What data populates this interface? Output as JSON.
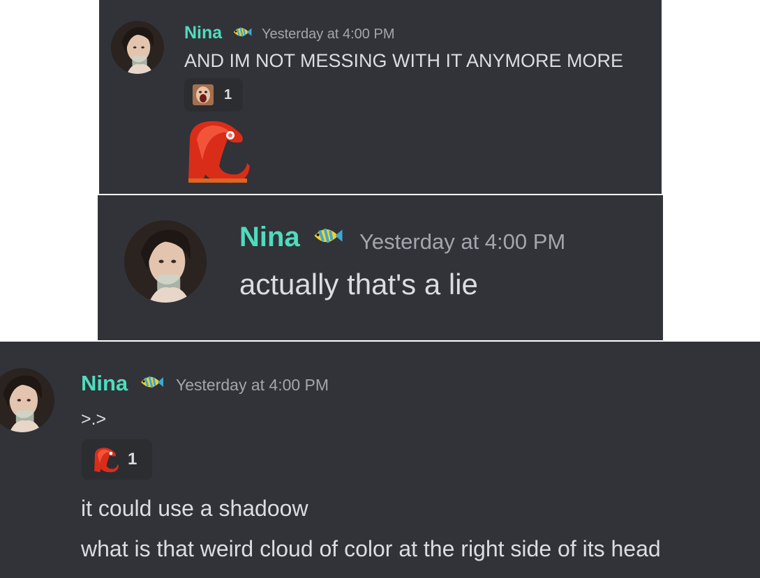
{
  "messages": [
    {
      "author": "Nina",
      "timestamp": "Yesterday at 4:00 PM",
      "lines": [
        "AND IM NOT MESSING WITH IT ANYMORE MORE"
      ],
      "reaction": {
        "emoji": "screaming-face-emoji",
        "count": "1"
      },
      "attachment": "red-bird-sticker"
    },
    {
      "author": "Nina",
      "timestamp": "Yesterday at 4:00 PM",
      "lines": [
        "actually that's a lie"
      ]
    },
    {
      "author": "Nina",
      "timestamp": "Yesterday at 4:00 PM",
      "lines": [
        ">.>",
        "it could use a shadoow",
        "what is that weird cloud of color at the right side of its head"
      ],
      "reaction": {
        "emoji": "red-bird-emoji",
        "count": "1"
      }
    }
  ],
  "colors": {
    "background": "#313338",
    "author": "#4fdcbd",
    "timestamp": "#a3a6ad",
    "text": "#dbdee1",
    "reaction_bg": "#2b2d31"
  }
}
